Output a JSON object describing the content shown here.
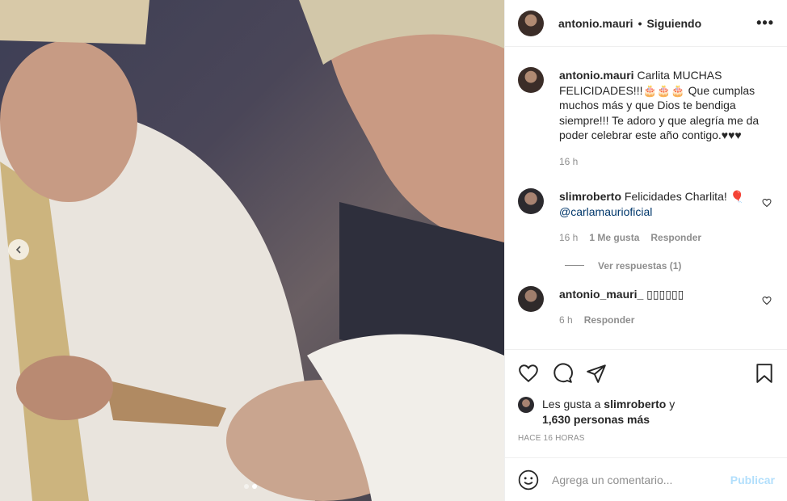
{
  "post": {
    "carousel_current": 2,
    "carousel_total": 2
  },
  "header": {
    "username": "antonio.mauri",
    "separator": "•",
    "follow_status": "Siguiendo",
    "more_icon": "more-horizontal-icon"
  },
  "caption": {
    "username": "antonio.mauri",
    "text": "Carlita MUCHAS FELICIDADES!!!🎂🎂🎂 Que cumplas muchos más y que Dios te bendiga siempre!!! Te adoro y que alegría me da poder celebrar este año contigo.♥♥♥",
    "time": "16 h"
  },
  "comments": [
    {
      "username": "slimroberto",
      "text": "Felicidades Charlita! 🎈",
      "mention": "@carlamaurioficial",
      "time": "16 h",
      "likes": "1 Me gusta",
      "reply": "Responder",
      "view_replies": "Ver respuestas (1)"
    },
    {
      "username": "antonio_mauri_",
      "text": "▯▯▯▯▯▯",
      "time": "6 h",
      "reply": "Responder"
    }
  ],
  "actions": {
    "like_icon": "heart-icon",
    "comment_icon": "comment-icon",
    "share_icon": "share-icon",
    "save_icon": "bookmark-icon"
  },
  "likes": {
    "prefix": "Les gusta a",
    "user": "slimroberto",
    "connector": "y",
    "others": "1,630 personas más"
  },
  "timestamp": "HACE 16 HORAS",
  "add_comment": {
    "placeholder": "Agrega un comentario...",
    "publish": "Publicar"
  },
  "colors": {
    "primary_text": "#262626",
    "secondary_text": "#8e8e8e",
    "link": "#00376b",
    "publish_disabled": "#b2dffc",
    "divider": "#efefef"
  }
}
